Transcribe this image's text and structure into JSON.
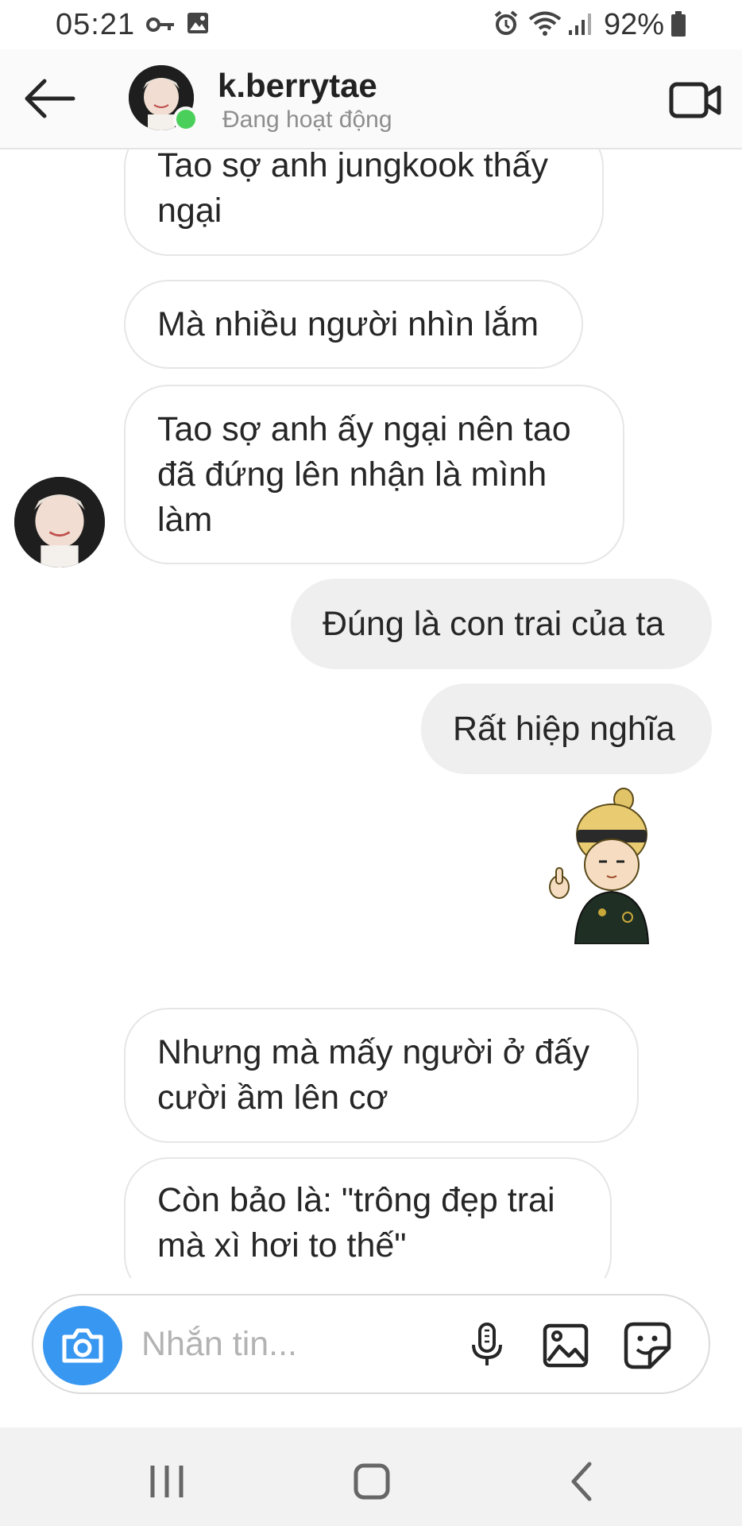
{
  "status_bar": {
    "time": "05:21",
    "battery": "92%",
    "icons": [
      "key-icon",
      "gallery-icon",
      "alarm-icon",
      "wifi-icon",
      "signal-icon",
      "battery-icon"
    ]
  },
  "header": {
    "username": "k.berrytae",
    "presence": "Đang hoạt động",
    "icons": [
      "back-arrow-icon",
      "video-call-icon"
    ],
    "online_color": "#4ad05a"
  },
  "messages": [
    {
      "side": "in",
      "text": "Tao sợ anh jungkook thấy ngại"
    },
    {
      "side": "in",
      "text": "Mà nhiều người nhìn lắm"
    },
    {
      "side": "in",
      "text": "Tao sợ anh ấy ngại nên tao đã đứng lên nhận là mình làm"
    },
    {
      "side": "out",
      "text": "Đúng là con trai của ta"
    },
    {
      "side": "out",
      "text": "Rất hiệp nghĩa"
    },
    {
      "side": "out",
      "type": "sticker",
      "icon": "sticker-thumbs-up-character"
    },
    {
      "side": "in",
      "text": "Nhưng mà mấy người ở đấy cười ầm lên cơ"
    },
    {
      "side": "in",
      "text": "Còn bảo là: \"trông đẹp trai mà xì hơi to thế\""
    }
  ],
  "composer": {
    "placeholder": "Nhắn tin...",
    "icons": [
      "camera-icon",
      "microphone-icon",
      "image-icon",
      "sticker-icon"
    ],
    "accent": "#3897f0"
  },
  "nav_bar": {
    "icons": [
      "recent-apps-icon",
      "home-icon",
      "back-icon"
    ]
  }
}
